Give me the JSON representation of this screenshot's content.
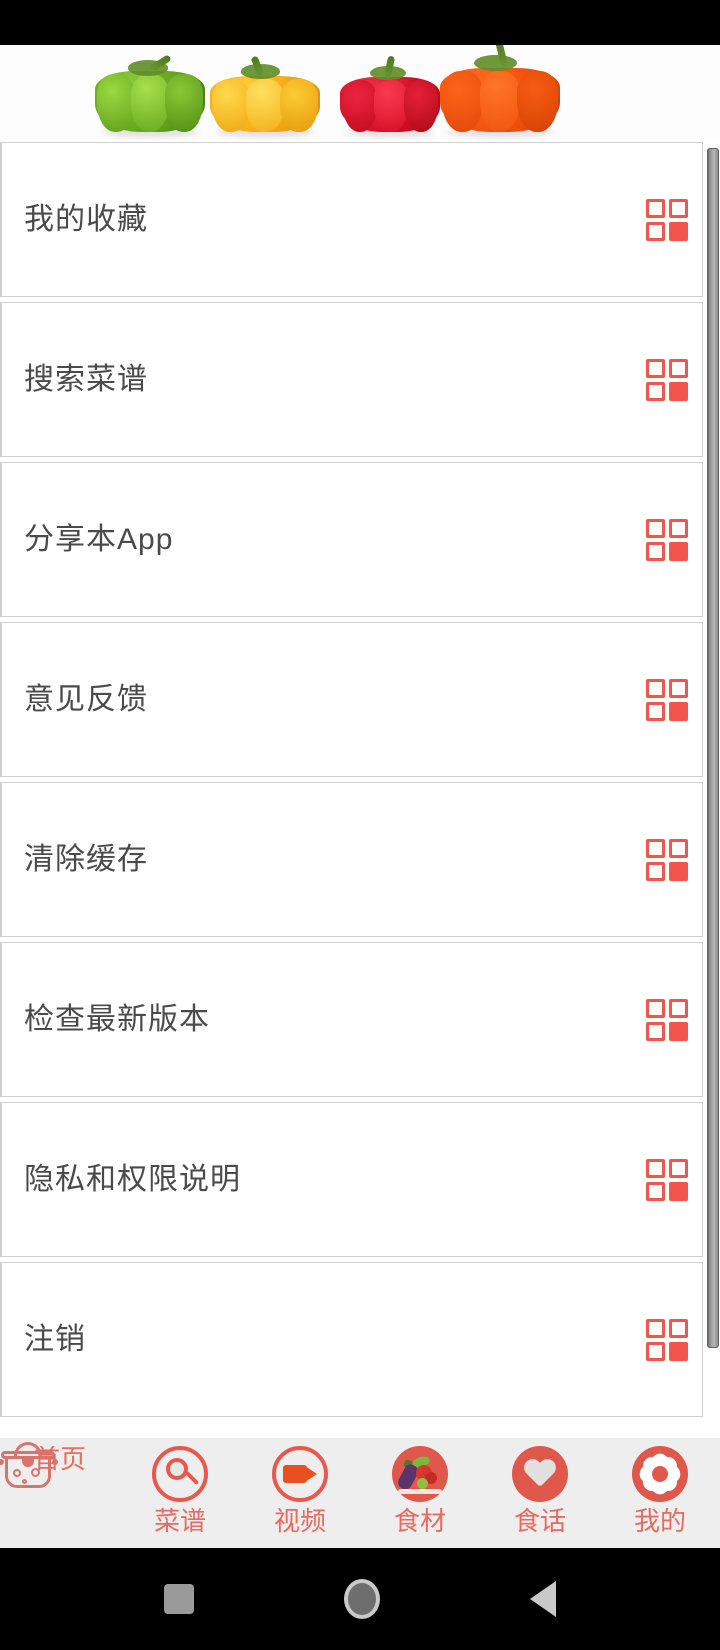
{
  "app": {
    "accent_color": "#f2564b",
    "tabbar_bg": "#eeeeee",
    "label_color": "#4a4a4a"
  },
  "banner": {
    "name": "bell-peppers-banner",
    "alt": "Four bell peppers: green, yellow, red, orange"
  },
  "menu": {
    "items": [
      {
        "label": "我的收藏",
        "icon": "grid-icon"
      },
      {
        "label": "搜索菜谱",
        "icon": "grid-icon"
      },
      {
        "label": "分享本App",
        "icon": "grid-icon"
      },
      {
        "label": "意见反馈",
        "icon": "grid-icon"
      },
      {
        "label": "清除缓存",
        "icon": "grid-icon"
      },
      {
        "label": "检查最新版本",
        "icon": "grid-icon"
      },
      {
        "label": "隐私和权限说明",
        "icon": "grid-icon"
      },
      {
        "label": "注销",
        "icon": "grid-icon"
      }
    ]
  },
  "tabbar": {
    "items": [
      {
        "label": "首页",
        "icon": "pot-icon"
      },
      {
        "label": "菜谱",
        "icon": "search-icon"
      },
      {
        "label": "视频",
        "icon": "video-icon"
      },
      {
        "label": "食材",
        "icon": "vegetables-icon"
      },
      {
        "label": "食话",
        "icon": "heart-icon"
      },
      {
        "label": "我的",
        "icon": "gear-icon"
      }
    ],
    "active": "我的"
  },
  "system_nav": {
    "recents": "recents-square",
    "home": "home-circle",
    "back": "back-triangle"
  }
}
